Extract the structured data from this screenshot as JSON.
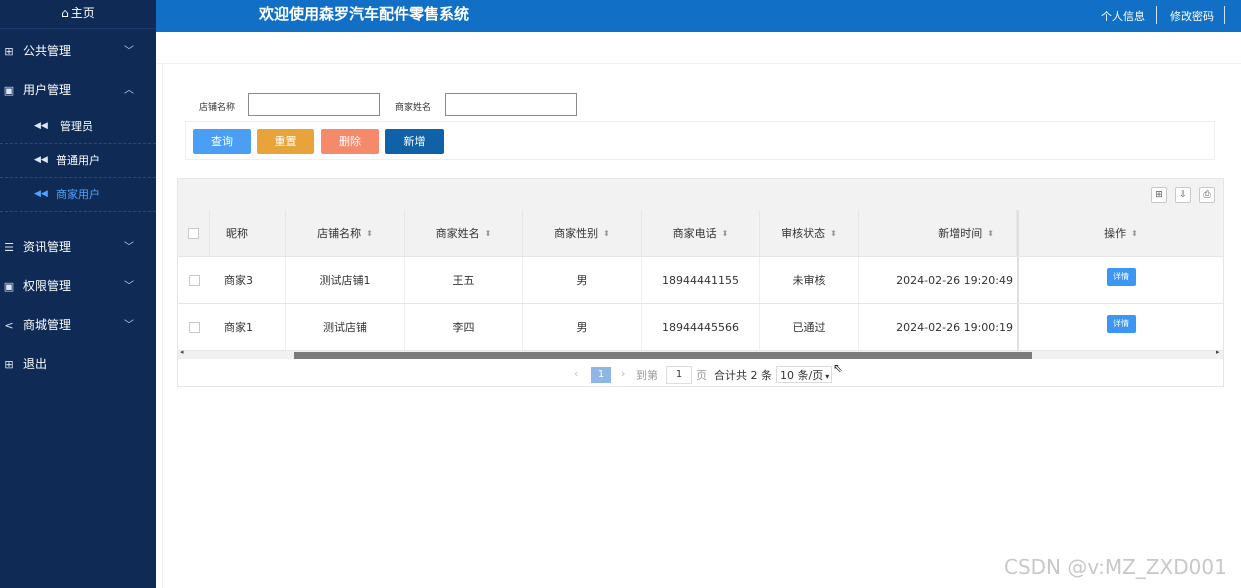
{
  "sidebar": {
    "home": "主页",
    "menus": [
      {
        "label": "公共管理"
      },
      {
        "label": "用户管理"
      },
      {
        "label": "资讯管理"
      },
      {
        "label": "权限管理"
      },
      {
        "label": "商城管理"
      },
      {
        "label": "退出"
      }
    ],
    "sub_items": [
      {
        "label": "管理员"
      },
      {
        "label": "普通用户"
      },
      {
        "label": "商家用户"
      }
    ]
  },
  "header": {
    "title": "欢迎使用森罗汽车配件零售系统",
    "profile": "个人信息",
    "change_password": "修改密码"
  },
  "filters": {
    "shop_name_label": "店铺名称",
    "merchant_name_label": "商家姓名",
    "shop_name_value": "",
    "merchant_name_value": ""
  },
  "buttons": {
    "query": "查询",
    "reset": "重置",
    "delete": "删除",
    "add": "新增"
  },
  "colors": {
    "query": "#4a9ff5",
    "reset": "#e8a33b",
    "delete": "#f58a6b",
    "add": "#0f62a8"
  },
  "table": {
    "columns": [
      "昵称",
      "店铺名称",
      "商家姓名",
      "商家性别",
      "商家电话",
      "审核状态",
      "新增时间",
      "操作"
    ],
    "rows": [
      {
        "nickname": "商家3",
        "shop": "测试店铺1",
        "name": "王五",
        "gender": "男",
        "phone": "18944441155",
        "status": "未审核",
        "time": "2024-02-26 19:20:49",
        "action": "详情"
      },
      {
        "nickname": "商家1",
        "shop": "测试店铺",
        "name": "李四",
        "gender": "男",
        "phone": "18944445566",
        "status": "已通过",
        "time": "2024-02-26 19:00:19",
        "action": "详情"
      }
    ]
  },
  "pager": {
    "current_page": "1",
    "goto_label": "到第",
    "goto_value": "1",
    "page_label": "页",
    "total": "合计共 2 条",
    "page_size": "10 条/页"
  },
  "watermark": "CSDN @v:MZ_ZXD001"
}
